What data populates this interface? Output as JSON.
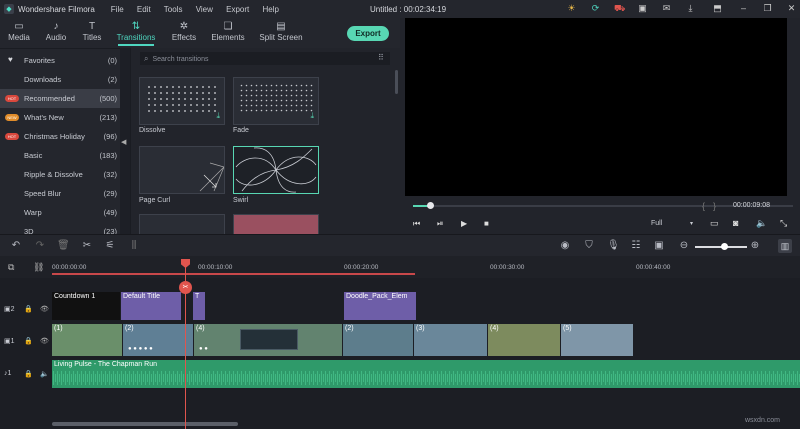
{
  "app": {
    "name": "Wondershare Filmora",
    "project_title": "Untitled : 00:02:34:19"
  },
  "menu": [
    "File",
    "Edit",
    "Tools",
    "View",
    "Export",
    "Help"
  ],
  "tabs": [
    {
      "label": "Media",
      "icon": "folder-icon"
    },
    {
      "label": "Audio",
      "icon": "music-note-icon"
    },
    {
      "label": "Titles",
      "icon": "text-T-icon"
    },
    {
      "label": "Transitions",
      "icon": "transition-icon",
      "active": true
    },
    {
      "label": "Effects",
      "icon": "effects-icon"
    },
    {
      "label": "Elements",
      "icon": "elements-icon"
    },
    {
      "label": "Split Screen",
      "icon": "split-screen-icon"
    }
  ],
  "export_label": "Export",
  "categories": [
    {
      "label": "Favorites",
      "count": "(0)",
      "icon": "heart-icon"
    },
    {
      "label": "Downloads",
      "count": "(2)"
    },
    {
      "label": "Recommended",
      "count": "(500)",
      "badge": "HOT",
      "selected": true
    },
    {
      "label": "What's New",
      "count": "(213)",
      "badge": "NEW"
    },
    {
      "label": "Christmas Holiday",
      "count": "(96)",
      "badge": "HOT"
    },
    {
      "label": "Basic",
      "count": "(183)"
    },
    {
      "label": "Ripple & Dissolve",
      "count": "(32)"
    },
    {
      "label": "Speed Blur",
      "count": "(29)"
    },
    {
      "label": "Warp",
      "count": "(49)"
    },
    {
      "label": "3D",
      "count": "(23)"
    }
  ],
  "search": {
    "placeholder": "Search transitions"
  },
  "transitions": [
    {
      "label": "Dissolve"
    },
    {
      "label": "Fade"
    },
    {
      "label": "Page Curl"
    },
    {
      "label": "Swirl",
      "selected": true
    }
  ],
  "player": {
    "timecode": "00:00:09:08",
    "quality": "Full"
  },
  "ruler": [
    "00:00:00:00",
    "00:00:10:00",
    "00:00:20:00",
    "00:00:30:00",
    "00:00:40:00"
  ],
  "track_labels": {
    "v2": "2",
    "v1": "1",
    "a1": "1"
  },
  "clips": {
    "title_track": [
      "Countdown 1",
      "Default Title",
      "T",
      "Doodle_Pack_Elem"
    ],
    "video_track": [
      "(1)",
      "(2)",
      "(4)",
      "(2)",
      "(3)",
      "(4)",
      "(5)"
    ],
    "audio_track": "Living Pulse - The Chapman Run"
  },
  "watermark": "wsxdn.com",
  "colors": {
    "accent": "#58d7b3",
    "playhead": "#e0554e",
    "audio": "#2f9a6a",
    "title_clip": "#6e5ea8"
  }
}
